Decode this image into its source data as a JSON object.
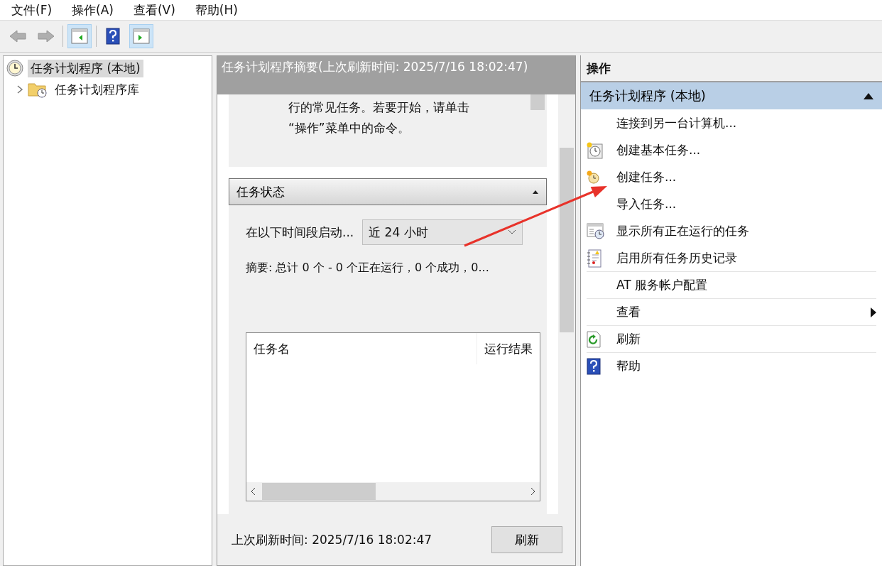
{
  "menu": [
    {
      "label": "文件(F)"
    },
    {
      "label": "操作(A)"
    },
    {
      "label": "查看(V)"
    },
    {
      "label": "帮助(H)"
    }
  ],
  "toolbar": [
    {
      "kind": "back",
      "disabled": true,
      "selected": false
    },
    {
      "kind": "forward",
      "disabled": true,
      "selected": false
    },
    {
      "kind": "tree-toggle",
      "disabled": false,
      "selected": true
    },
    {
      "kind": "help",
      "disabled": false,
      "selected": false
    },
    {
      "kind": "action-toggle",
      "disabled": false,
      "selected": true
    }
  ],
  "tree": [
    {
      "label": "任务计划程序 (本地)",
      "kind": "clock",
      "selected": true,
      "children": [
        {
          "label": "任务计划程序库",
          "kind": "folder",
          "selected": false,
          "expanded": false
        }
      ]
    }
  ],
  "summary": {
    "title": "任务计划程序摘要(上次刷新时间: 2025/7/16 18:02:47)",
    "description_lines": [
      "行的常见任务。若要开始，请单击",
      "“操作”菜单中的命令。"
    ],
    "status": {
      "title": "任务状态",
      "expanded": true,
      "filter_label": "在以下时间段启动...",
      "filter_value": "近 24 小时",
      "summary": "摘要: 总计 0 个 - 0 个正在运行，0 个成功，0...",
      "table": {
        "columns": [
          "任务名",
          "运行结果"
        ]
      }
    },
    "last_refresh": "上次刷新时间: 2025/7/16 18:02:47",
    "refresh_button": "刷新"
  },
  "actions": {
    "title": "操作",
    "groups": [
      {
        "title": "任务计划程序 (本地)",
        "expanded": true,
        "items": [
          {
            "label": "连接到另一台计算机...",
            "kind": "plain",
            "divider_before": false,
            "submenu": false
          },
          {
            "label": "创建基本任务...",
            "kind": "basic-task",
            "divider_before": false,
            "submenu": false
          },
          {
            "label": "创建任务...",
            "kind": "task",
            "divider_before": false,
            "submenu": false
          },
          {
            "label": "导入任务...",
            "kind": "plain",
            "divider_before": false,
            "submenu": false
          },
          {
            "label": "显示所有正在运行的任务",
            "kind": "running",
            "divider_before": false,
            "submenu": false
          },
          {
            "label": "启用所有任务历史记录",
            "kind": "history",
            "divider_before": false,
            "submenu": false
          },
          {
            "label": "AT 服务帐户配置",
            "kind": "plain",
            "divider_before": true,
            "submenu": false
          },
          {
            "label": "查看",
            "kind": "plain",
            "divider_before": true,
            "submenu": true
          },
          {
            "label": "刷新",
            "kind": "refresh",
            "divider_before": true,
            "submenu": false
          },
          {
            "label": "帮助",
            "kind": "help",
            "divider_before": true,
            "submenu": false
          }
        ]
      }
    ]
  },
  "annotations": [
    {
      "kind": "arrow"
    }
  ]
}
